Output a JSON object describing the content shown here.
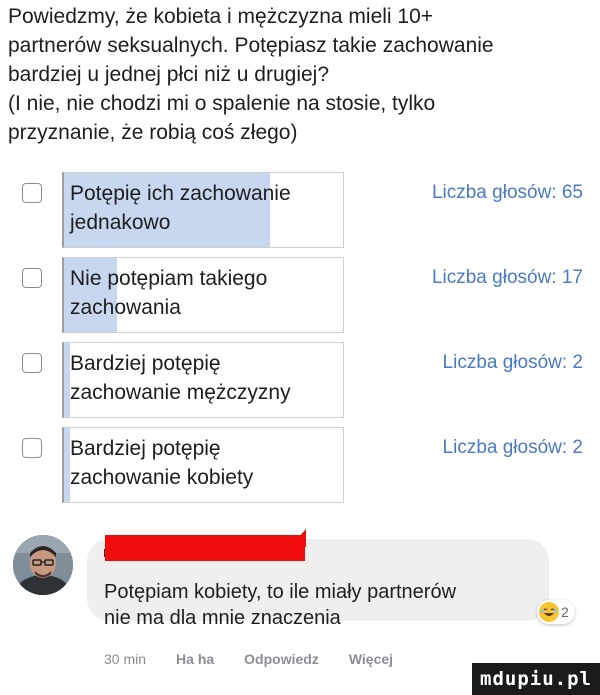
{
  "question": {
    "lines": [
      "Powiedzmy, że kobieta i mężczyzna mieli 10+",
      "partnerów seksualnych. Potępiasz takie zachowanie",
      "bardziej u jednej płci niż u drugiej?",
      "(I nie, nie chodzi mi o spalenie na stosie, tylko",
      "przyznanie, że robią coś złego)"
    ]
  },
  "poll": {
    "options": [
      {
        "line1": "Potępię ich zachowanie",
        "line2": "jednakowo",
        "votes_label": "Liczba głosów: 65",
        "votes": 65,
        "fill_fraction": 0.74
      },
      {
        "line1": "Nie potępiam takiego",
        "line2": "zachowania",
        "votes_label": "Liczba głosów: 17",
        "votes": 17,
        "fill_fraction": 0.19
      },
      {
        "line1": "Bardziej potępię",
        "line2": "zachowanie mężczyzny",
        "votes_label": "Liczba głosów: 2",
        "votes": 2,
        "fill_fraction": 0.02
      },
      {
        "line1": "Bardziej potępię",
        "line2": "zachowanie kobiety",
        "votes_label": "Liczba głosów: 2",
        "votes": 2,
        "fill_fraction": 0.02
      }
    ],
    "fill_color": "#c7d7f0",
    "votes_color": "#4a79c6"
  },
  "comment": {
    "lines": [
      "Potępiam kobiety, to ile miały partnerów",
      "nie ma dla mnie znaczenia"
    ],
    "reaction_icon": "laughing-emoji-icon",
    "reaction_count": "2",
    "time": "30 min",
    "actions": [
      "Ha ha",
      "Odpowiedz",
      "Więcej"
    ]
  },
  "watermark": "mdupiu.pl"
}
